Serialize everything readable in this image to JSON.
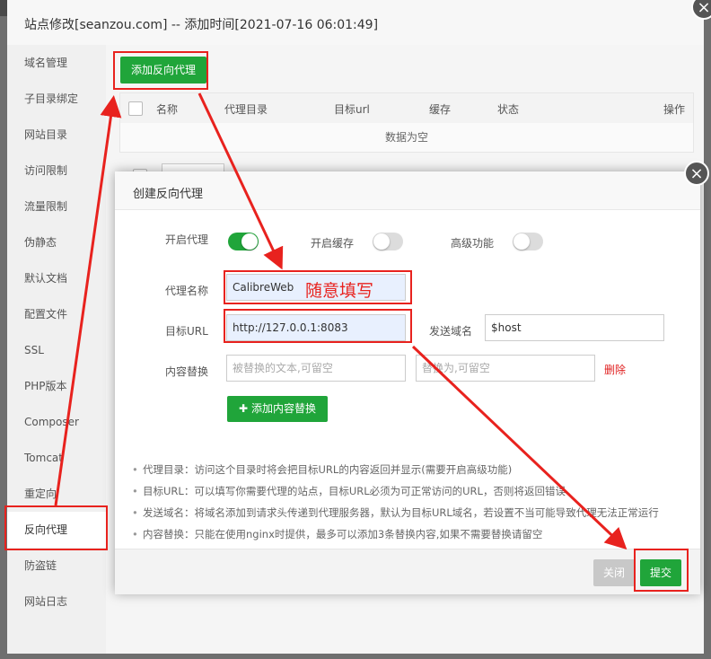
{
  "window": {
    "title": "站点修改[seanzou.com] -- 添加时间[2021-07-16 06:01:49]"
  },
  "sidebar": {
    "items": [
      {
        "label": "域名管理"
      },
      {
        "label": "子目录绑定"
      },
      {
        "label": "网站目录"
      },
      {
        "label": "访问限制"
      },
      {
        "label": "流量限制"
      },
      {
        "label": "伪静态"
      },
      {
        "label": "默认文档"
      },
      {
        "label": "配置文件"
      },
      {
        "label": "SSL"
      },
      {
        "label": "PHP版本"
      },
      {
        "label": "Composer"
      },
      {
        "label": "Tomcat"
      },
      {
        "label": "重定向"
      },
      {
        "label": "反向代理"
      },
      {
        "label": "防盗链"
      },
      {
        "label": "网站日志"
      }
    ],
    "active_index": 13
  },
  "main": {
    "add_button": "添加反向代理",
    "table": {
      "columns": [
        "名称",
        "代理目录",
        "目标url",
        "缓存",
        "状态",
        "操作"
      ],
      "empty_text": "数据为空"
    }
  },
  "modal": {
    "title": "创建反向代理",
    "enable_proxy_label": "开启代理",
    "enable_proxy_on": true,
    "enable_cache_label": "开启缓存",
    "enable_cache_on": false,
    "advanced_label": "高级功能",
    "advanced_on": false,
    "proxy_name_label": "代理名称",
    "proxy_name_value": "CalibreWeb",
    "target_url_label": "目标URL",
    "target_url_value": "http://127.0.0.1:8083",
    "send_domain_label": "发送域名",
    "send_domain_value": "$host",
    "content_replace_label": "内容替换",
    "replace_from_placeholder": "被替换的文本,可留空",
    "replace_to_placeholder": "替换为,可留空",
    "delete_label": "删除",
    "add_replace_button": "添加内容替换",
    "tips": [
      "代理目录：访问这个目录时将会把目标URL的内容返回并显示(需要开启高级功能)",
      "目标URL：可以填写你需要代理的站点，目标URL必须为可正常访问的URL，否则将返回错误",
      "发送域名：将域名添加到请求头传递到代理服务器，默认为目标URL域名，若设置不当可能导致代理无法正常运行",
      "内容替换：只能在使用nginx时提供，最多可以添加3条替换内容,如果不需要替换请留空"
    ],
    "close_button": "关闭",
    "submit_button": "提交"
  },
  "annotation": {
    "note": "随意填写",
    "color": "#e8221e"
  },
  "colors": {
    "accent": "#20a53a",
    "danger": "#e02020"
  },
  "icons": {
    "close": "×",
    "plus": "✚"
  }
}
